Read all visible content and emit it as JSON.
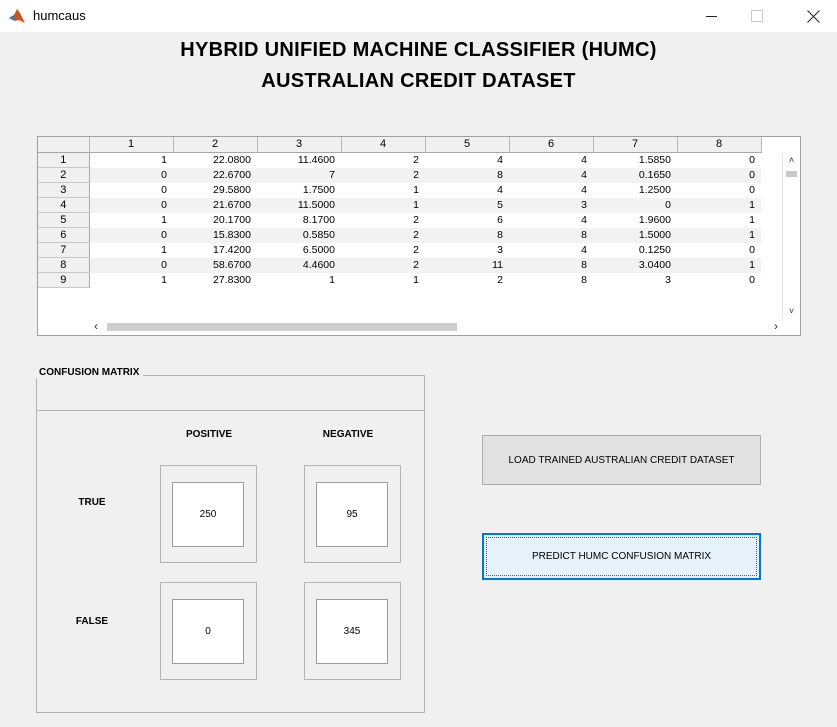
{
  "window": {
    "title": "humcaus"
  },
  "headings": {
    "line1": "HYBRID UNIFIED MACHINE CLASSIFIER (HUMC)",
    "line2": "AUSTRALIAN CREDIT DATASET"
  },
  "table": {
    "columns": [
      "1",
      "2",
      "3",
      "4",
      "5",
      "6",
      "7",
      "8"
    ],
    "rows": [
      {
        "label": "1",
        "cells": [
          "1",
          "22.0800",
          "11.4600",
          "2",
          "4",
          "4",
          "1.5850",
          "0"
        ]
      },
      {
        "label": "2",
        "cells": [
          "0",
          "22.6700",
          "7",
          "2",
          "8",
          "4",
          "0.1650",
          "0"
        ]
      },
      {
        "label": "3",
        "cells": [
          "0",
          "29.5800",
          "1.7500",
          "1",
          "4",
          "4",
          "1.2500",
          "0"
        ]
      },
      {
        "label": "4",
        "cells": [
          "0",
          "21.6700",
          "11.5000",
          "1",
          "5",
          "3",
          "0",
          "1"
        ]
      },
      {
        "label": "5",
        "cells": [
          "1",
          "20.1700",
          "8.1700",
          "2",
          "6",
          "4",
          "1.9600",
          "1"
        ]
      },
      {
        "label": "6",
        "cells": [
          "0",
          "15.8300",
          "0.5850",
          "2",
          "8",
          "8",
          "1.5000",
          "1"
        ]
      },
      {
        "label": "7",
        "cells": [
          "1",
          "17.4200",
          "6.5000",
          "2",
          "3",
          "4",
          "0.1250",
          "0"
        ]
      },
      {
        "label": "8",
        "cells": [
          "0",
          "58.6700",
          "4.4600",
          "2",
          "11",
          "8",
          "3.0400",
          "1"
        ]
      },
      {
        "label": "9",
        "cells": [
          "1",
          "27.8300",
          "1",
          "1",
          "2",
          "8",
          "3",
          "0"
        ]
      }
    ]
  },
  "confusion": {
    "title": "CONFUSION MATRIX",
    "col_positive": "POSITIVE",
    "col_negative": "NEGATIVE",
    "row_true": "TRUE",
    "row_false": "FALSE",
    "true_positive": "250",
    "true_negative": "95",
    "false_positive": "0",
    "false_negative": "345"
  },
  "buttons": {
    "load": "LOAD TRAINED AUSTRALIAN CREDIT DATASET",
    "predict": "PREDICT HUMC CONFUSION MATRIX"
  },
  "icons": {
    "app": "matlab-icon",
    "minimize": "minimize-icon",
    "maximize": "maximize-icon",
    "close": "close-icon"
  }
}
